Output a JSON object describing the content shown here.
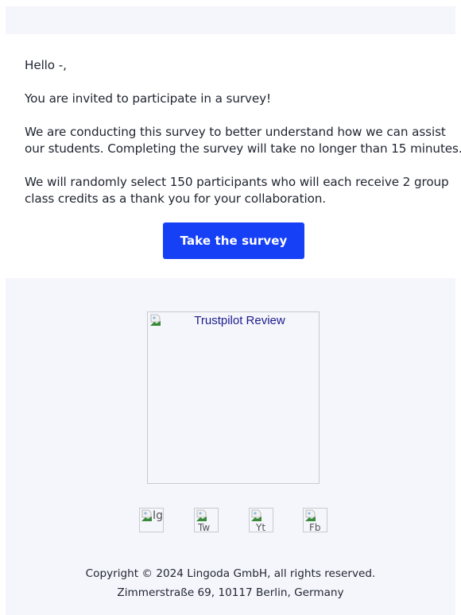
{
  "email": {
    "greeting": "Hello -,",
    "paragraphs": {
      "invite": "You are invited to participate in a survey!",
      "conduct_line1": "We are conducting this survey to better understand how we can assist",
      "conduct_line2": "our students. Completing the survey will take no longer than 15 minutes.",
      "select_line1": "We will randomly select 150 participants who will each receive 2 group",
      "select_line2": "class credits as a thank you for your collaboration."
    },
    "cta_label": "Take the survey",
    "accent_color": "#1640f6"
  },
  "footer": {
    "trustpilot_alt": "Trustpilot Review",
    "social": [
      {
        "alt": "Ig",
        "icon": "instagram-icon"
      },
      {
        "alt": "Tw",
        "icon": "twitter-icon"
      },
      {
        "alt": "Yt",
        "icon": "youtube-icon"
      },
      {
        "alt": "Fb",
        "icon": "facebook-icon"
      }
    ],
    "copyright": "Copyright © 2024 Lingoda GmbH, all rights reserved.",
    "address": "Zimmerstraße 69, 10117 Berlin, Germany"
  }
}
